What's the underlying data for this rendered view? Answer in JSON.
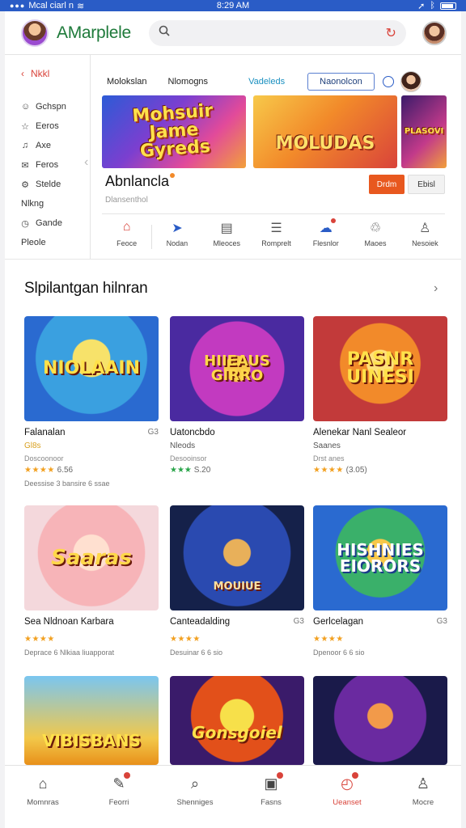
{
  "status": {
    "carrier": "Mcal ciarl n",
    "time": "8:29 AM"
  },
  "header": {
    "brand": "AMarplele",
    "search_placeholder": ""
  },
  "sidebar": {
    "head": "Nkkl",
    "items": [
      {
        "icon": "user-circle-icon",
        "glyph": "☺",
        "label": "Gchspn"
      },
      {
        "icon": "star-icon",
        "glyph": "☆",
        "label": "Eeros"
      },
      {
        "icon": "bell-icon",
        "glyph": "♫",
        "label": "Axe"
      },
      {
        "icon": "mail-icon",
        "glyph": "✉",
        "label": "Feros"
      },
      {
        "icon": "settings-icon",
        "glyph": "⚙",
        "label": "Stelde"
      },
      {
        "icon": "",
        "glyph": "",
        "label": "Nlkng"
      },
      {
        "icon": "clock-icon",
        "glyph": "◷",
        "label": "Gande"
      },
      {
        "icon": "",
        "glyph": "",
        "label": "Pleole"
      }
    ]
  },
  "topnav": {
    "t1": "Molokslan",
    "t2": "Nlomogns",
    "t3": "Vadeleds",
    "pill": "Naonolcon"
  },
  "banners": {
    "b1": "Mohsuir\nJame\nGyreds",
    "b2": "MOLUDAS",
    "b3": "PLASOVI"
  },
  "product": {
    "title": "Abnlancla",
    "subtitle": "Dlansenthol",
    "btn_primary": "Drdm",
    "btn_secondary": "Ebisl"
  },
  "quick": [
    {
      "icon": "home-icon",
      "label": "Feoce"
    },
    {
      "icon": "send-icon",
      "label": "Nodan"
    },
    {
      "icon": "calendar-icon",
      "label": "Mleoces"
    },
    {
      "icon": "document-icon",
      "label": "Romprelt"
    },
    {
      "icon": "cloud-icon",
      "label": "Flesnlor"
    },
    {
      "icon": "recycle-icon",
      "label": "Maoes"
    },
    {
      "icon": "person-icon",
      "label": "Nesoiek"
    }
  ],
  "section": {
    "title": "Slpilantgan hilnran"
  },
  "cards": [
    {
      "thumb_text": "NIOLAAIN",
      "name": "Falanalan",
      "mini": "G3",
      "sub": "Gl8s",
      "meta": "Doscoonoor",
      "stars": "★★★★",
      "score": "6.56",
      "desc": "Deessise 3 bansire 6 ssae"
    },
    {
      "thumb_text": "HIIEAUS\nGIRRO",
      "name": "Uatoncbdo",
      "mini": "",
      "sub": "Nleods",
      "meta": "Desooinsor",
      "stars": "★★★",
      "score": "S.20",
      "desc": ""
    },
    {
      "thumb_text": "PASNR\nUINESI",
      "name": "Alenekar Nanl Sealeor",
      "mini": "",
      "sub": "Saanes",
      "meta": "Drst anes",
      "stars": "★★★★",
      "score": "(3.05)",
      "desc": ""
    },
    {
      "thumb_text": "Saaras",
      "name": "Sea Nldnoan Karbara",
      "mini": "",
      "sub": "",
      "meta": "",
      "stars": "★★★★",
      "score": "",
      "desc": "Deprace 6 Nlkiaa liuapporat"
    },
    {
      "thumb_text": "MOUIUE",
      "name": "Canteadalding",
      "mini": "G3",
      "sub": "",
      "meta": "",
      "stars": "★★★★",
      "score": "",
      "desc": "Desuinar 6 6 sio"
    },
    {
      "thumb_text": "HISHNIES\nEIORORS",
      "name": "Gerlcelagan",
      "mini": "G3",
      "sub": "",
      "meta": "",
      "stars": "★★★★",
      "score": "",
      "desc": "Dpenoor 6 6 sio"
    },
    {
      "thumb_text": "VIBISBANS"
    },
    {
      "thumb_text": "Gonsgoiel"
    },
    {
      "thumb_text": ""
    }
  ],
  "bottom": [
    {
      "icon": "home-icon",
      "label": "Momnras"
    },
    {
      "icon": "edit-icon",
      "label": "Feorri"
    },
    {
      "icon": "search-icon",
      "label": "Shenniges"
    },
    {
      "icon": "image-icon",
      "label": "Fasns"
    },
    {
      "icon": "notifications-icon",
      "label": "Ueanset"
    },
    {
      "icon": "profile-icon",
      "label": "Mocre"
    }
  ],
  "colors": {
    "accent": "#d9433a",
    "brand": "#1e7a3a",
    "statusbar": "#2a5cc6",
    "primary_btn": "#e8581f"
  }
}
